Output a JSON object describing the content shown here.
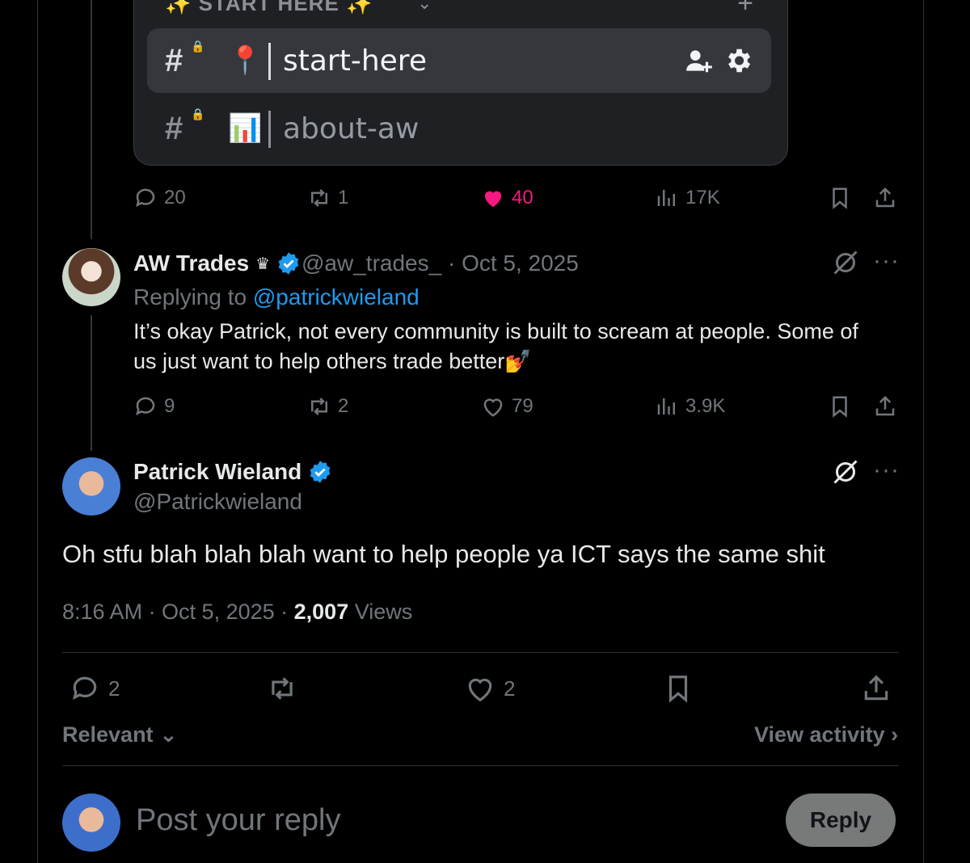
{
  "embed": {
    "category_label": "✨ START HERE ✨",
    "channels": [
      {
        "emoji": "📍",
        "name": "start-here",
        "active": true
      },
      {
        "emoji": "📊",
        "name": "about-aw",
        "active": false
      }
    ]
  },
  "first_tweet_actions": {
    "replies": "20",
    "reposts": "1",
    "likes": "40",
    "views": "17K"
  },
  "reply_tweet": {
    "author_name": "AW Trades",
    "crown": "♛",
    "handle": "@aw_trades_",
    "date": "· Oct 5, 2025",
    "replying_prefix": "Replying to ",
    "replying_handle": "@patrickwieland",
    "text_line1": "It’s okay Patrick, not every community is built to scream at people. Some of",
    "text_line2": "us just want to help others trade better💅",
    "replies": "9",
    "reposts": "2",
    "likes": "79",
    "views": "3.9K"
  },
  "main_tweet": {
    "author_name": "Patrick Wieland",
    "handle": "@Patrickwieland",
    "text": "Oh stfu blah blah blah want to help people ya ICT says the same shit",
    "time": "8:16 AM · Oct 5, 2025 · ",
    "views_count": "2,007",
    "views_label": " Views",
    "replies": "2",
    "likes": "2"
  },
  "sort_label": "Relevant",
  "view_activity_label": "View activity",
  "reply_placeholder": "Post your reply",
  "reply_button": "Reply",
  "colors": {
    "background": "#000000",
    "like_pink": "#f91880",
    "link_blue": "#1d9bf0",
    "muted": "#71767b"
  }
}
